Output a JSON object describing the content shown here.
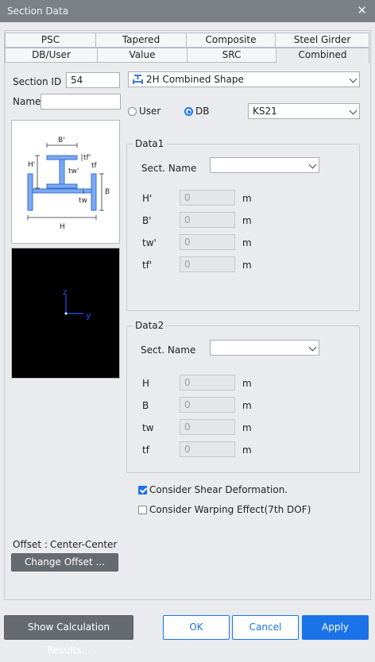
{
  "window": {
    "title": "Section Data",
    "close": "✕"
  },
  "tabs_row1": [
    "PSC",
    "Tapered",
    "Composite",
    "Steel Girder"
  ],
  "tabs_row2": [
    "DB/User",
    "Value",
    "SRC",
    "Combined"
  ],
  "section": {
    "id_label": "Section ID",
    "id_value": "54",
    "name_label": "Name",
    "name_value": ""
  },
  "shape": {
    "selected": "2H Combined Shape"
  },
  "source": {
    "user_label": "User",
    "db_label": "DB",
    "selected": "DB",
    "db_value": "KS21"
  },
  "diagram_labels": {
    "b1": "B'",
    "tf1": "tf'",
    "h1": "H'",
    "tw1": "tw'",
    "tf": "tf",
    "b": "B",
    "tw": "tw",
    "h": "H"
  },
  "axes": {
    "z": "z",
    "y": "y"
  },
  "data1": {
    "title": "Data1",
    "sect_name_label": "Sect. Name",
    "sect_name_value": "",
    "rows": [
      {
        "label": "H'",
        "value": "0",
        "unit": "m"
      },
      {
        "label": "B'",
        "value": "0",
        "unit": "m"
      },
      {
        "label": "tw'",
        "value": "0",
        "unit": "m"
      },
      {
        "label": "tf'",
        "value": "0",
        "unit": "m"
      }
    ]
  },
  "data2": {
    "title": "Data2",
    "sect_name_label": "Sect. Name",
    "sect_name_value": "",
    "rows": [
      {
        "label": "H",
        "value": "0",
        "unit": "m"
      },
      {
        "label": "B",
        "value": "0",
        "unit": "m"
      },
      {
        "label": "tw",
        "value": "0",
        "unit": "m"
      },
      {
        "label": "tf",
        "value": "0",
        "unit": "m"
      }
    ]
  },
  "options": {
    "shear": {
      "label": "Consider Shear Deformation.",
      "checked": true
    },
    "warping": {
      "label": "Consider Warping Effect(7th DOF)",
      "checked": false
    }
  },
  "offset": {
    "label": "Offset :",
    "value": "Center-Center",
    "button": "Change Offset ..."
  },
  "footer": {
    "calc": "Show Calculation Results...",
    "ok": "OK",
    "cancel": "Cancel",
    "apply": "Apply"
  },
  "colors": {
    "accent": "#1a73e8",
    "shape_fill": "#6aa0f0",
    "titlebar": "#7c8087"
  }
}
